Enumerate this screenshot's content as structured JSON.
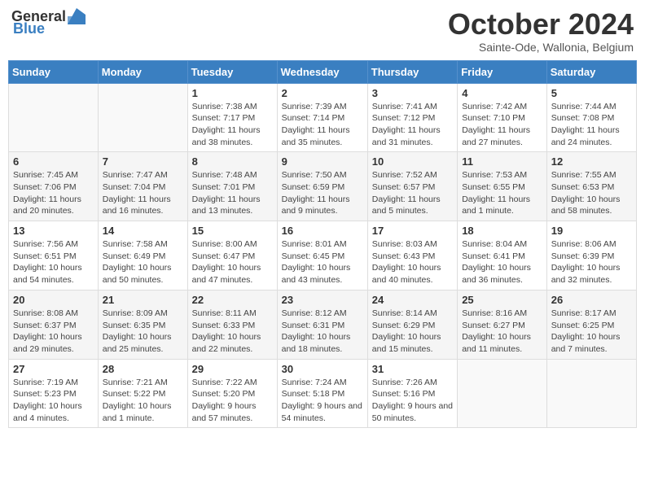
{
  "header": {
    "logo_general": "General",
    "logo_blue": "Blue",
    "month_title": "October 2024",
    "subtitle": "Sainte-Ode, Wallonia, Belgium"
  },
  "days_of_week": [
    "Sunday",
    "Monday",
    "Tuesday",
    "Wednesday",
    "Thursday",
    "Friday",
    "Saturday"
  ],
  "weeks": [
    [
      {
        "day": "",
        "sunrise": "",
        "sunset": "",
        "daylight": ""
      },
      {
        "day": "",
        "sunrise": "",
        "sunset": "",
        "daylight": ""
      },
      {
        "day": "1",
        "sunrise": "Sunrise: 7:38 AM",
        "sunset": "Sunset: 7:17 PM",
        "daylight": "Daylight: 11 hours and 38 minutes."
      },
      {
        "day": "2",
        "sunrise": "Sunrise: 7:39 AM",
        "sunset": "Sunset: 7:14 PM",
        "daylight": "Daylight: 11 hours and 35 minutes."
      },
      {
        "day": "3",
        "sunrise": "Sunrise: 7:41 AM",
        "sunset": "Sunset: 7:12 PM",
        "daylight": "Daylight: 11 hours and 31 minutes."
      },
      {
        "day": "4",
        "sunrise": "Sunrise: 7:42 AM",
        "sunset": "Sunset: 7:10 PM",
        "daylight": "Daylight: 11 hours and 27 minutes."
      },
      {
        "day": "5",
        "sunrise": "Sunrise: 7:44 AM",
        "sunset": "Sunset: 7:08 PM",
        "daylight": "Daylight: 11 hours and 24 minutes."
      }
    ],
    [
      {
        "day": "6",
        "sunrise": "Sunrise: 7:45 AM",
        "sunset": "Sunset: 7:06 PM",
        "daylight": "Daylight: 11 hours and 20 minutes."
      },
      {
        "day": "7",
        "sunrise": "Sunrise: 7:47 AM",
        "sunset": "Sunset: 7:04 PM",
        "daylight": "Daylight: 11 hours and 16 minutes."
      },
      {
        "day": "8",
        "sunrise": "Sunrise: 7:48 AM",
        "sunset": "Sunset: 7:01 PM",
        "daylight": "Daylight: 11 hours and 13 minutes."
      },
      {
        "day": "9",
        "sunrise": "Sunrise: 7:50 AM",
        "sunset": "Sunset: 6:59 PM",
        "daylight": "Daylight: 11 hours and 9 minutes."
      },
      {
        "day": "10",
        "sunrise": "Sunrise: 7:52 AM",
        "sunset": "Sunset: 6:57 PM",
        "daylight": "Daylight: 11 hours and 5 minutes."
      },
      {
        "day": "11",
        "sunrise": "Sunrise: 7:53 AM",
        "sunset": "Sunset: 6:55 PM",
        "daylight": "Daylight: 11 hours and 1 minute."
      },
      {
        "day": "12",
        "sunrise": "Sunrise: 7:55 AM",
        "sunset": "Sunset: 6:53 PM",
        "daylight": "Daylight: 10 hours and 58 minutes."
      }
    ],
    [
      {
        "day": "13",
        "sunrise": "Sunrise: 7:56 AM",
        "sunset": "Sunset: 6:51 PM",
        "daylight": "Daylight: 10 hours and 54 minutes."
      },
      {
        "day": "14",
        "sunrise": "Sunrise: 7:58 AM",
        "sunset": "Sunset: 6:49 PM",
        "daylight": "Daylight: 10 hours and 50 minutes."
      },
      {
        "day": "15",
        "sunrise": "Sunrise: 8:00 AM",
        "sunset": "Sunset: 6:47 PM",
        "daylight": "Daylight: 10 hours and 47 minutes."
      },
      {
        "day": "16",
        "sunrise": "Sunrise: 8:01 AM",
        "sunset": "Sunset: 6:45 PM",
        "daylight": "Daylight: 10 hours and 43 minutes."
      },
      {
        "day": "17",
        "sunrise": "Sunrise: 8:03 AM",
        "sunset": "Sunset: 6:43 PM",
        "daylight": "Daylight: 10 hours and 40 minutes."
      },
      {
        "day": "18",
        "sunrise": "Sunrise: 8:04 AM",
        "sunset": "Sunset: 6:41 PM",
        "daylight": "Daylight: 10 hours and 36 minutes."
      },
      {
        "day": "19",
        "sunrise": "Sunrise: 8:06 AM",
        "sunset": "Sunset: 6:39 PM",
        "daylight": "Daylight: 10 hours and 32 minutes."
      }
    ],
    [
      {
        "day": "20",
        "sunrise": "Sunrise: 8:08 AM",
        "sunset": "Sunset: 6:37 PM",
        "daylight": "Daylight: 10 hours and 29 minutes."
      },
      {
        "day": "21",
        "sunrise": "Sunrise: 8:09 AM",
        "sunset": "Sunset: 6:35 PM",
        "daylight": "Daylight: 10 hours and 25 minutes."
      },
      {
        "day": "22",
        "sunrise": "Sunrise: 8:11 AM",
        "sunset": "Sunset: 6:33 PM",
        "daylight": "Daylight: 10 hours and 22 minutes."
      },
      {
        "day": "23",
        "sunrise": "Sunrise: 8:12 AM",
        "sunset": "Sunset: 6:31 PM",
        "daylight": "Daylight: 10 hours and 18 minutes."
      },
      {
        "day": "24",
        "sunrise": "Sunrise: 8:14 AM",
        "sunset": "Sunset: 6:29 PM",
        "daylight": "Daylight: 10 hours and 15 minutes."
      },
      {
        "day": "25",
        "sunrise": "Sunrise: 8:16 AM",
        "sunset": "Sunset: 6:27 PM",
        "daylight": "Daylight: 10 hours and 11 minutes."
      },
      {
        "day": "26",
        "sunrise": "Sunrise: 8:17 AM",
        "sunset": "Sunset: 6:25 PM",
        "daylight": "Daylight: 10 hours and 7 minutes."
      }
    ],
    [
      {
        "day": "27",
        "sunrise": "Sunrise: 7:19 AM",
        "sunset": "Sunset: 5:23 PM",
        "daylight": "Daylight: 10 hours and 4 minutes."
      },
      {
        "day": "28",
        "sunrise": "Sunrise: 7:21 AM",
        "sunset": "Sunset: 5:22 PM",
        "daylight": "Daylight: 10 hours and 1 minute."
      },
      {
        "day": "29",
        "sunrise": "Sunrise: 7:22 AM",
        "sunset": "Sunset: 5:20 PM",
        "daylight": "Daylight: 9 hours and 57 minutes."
      },
      {
        "day": "30",
        "sunrise": "Sunrise: 7:24 AM",
        "sunset": "Sunset: 5:18 PM",
        "daylight": "Daylight: 9 hours and 54 minutes."
      },
      {
        "day": "31",
        "sunrise": "Sunrise: 7:26 AM",
        "sunset": "Sunset: 5:16 PM",
        "daylight": "Daylight: 9 hours and 50 minutes."
      },
      {
        "day": "",
        "sunrise": "",
        "sunset": "",
        "daylight": ""
      },
      {
        "day": "",
        "sunrise": "",
        "sunset": "",
        "daylight": ""
      }
    ]
  ]
}
